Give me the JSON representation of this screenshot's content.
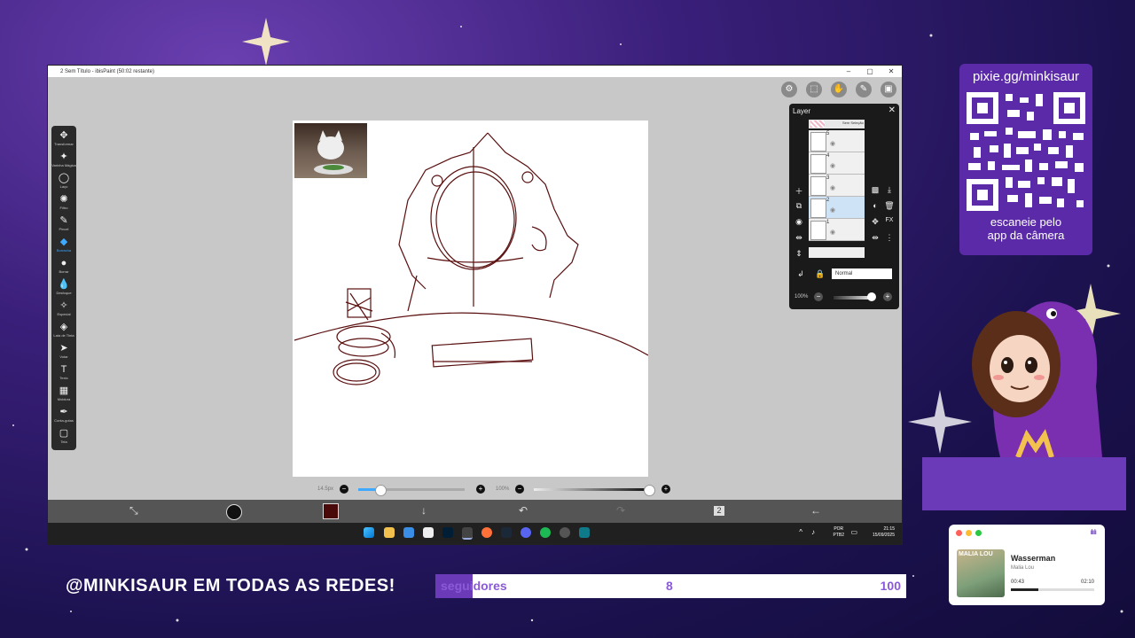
{
  "window": {
    "title": "2 Sem Título - ibisPaint (50:02 restante)",
    "minimize": "–",
    "maximize": "▢",
    "close": "✕"
  },
  "tools": [
    {
      "label": "Transformar",
      "icon": "move-icon",
      "glyph": "✥"
    },
    {
      "label": "Varinha Mágica",
      "icon": "magic-wand-icon",
      "glyph": "✦"
    },
    {
      "label": "Laço",
      "icon": "lasso-icon",
      "glyph": "◯"
    },
    {
      "label": "Filtro",
      "icon": "filter-icon",
      "glyph": "✺"
    },
    {
      "label": "Pincel",
      "icon": "brush-icon",
      "glyph": "✎"
    },
    {
      "label": "Borracha",
      "icon": "eraser-icon",
      "glyph": "◆"
    },
    {
      "label": "Borrar",
      "icon": "smudge-icon",
      "glyph": "●"
    },
    {
      "label": "Desfoque",
      "icon": "blur-icon",
      "glyph": "💧"
    },
    {
      "label": "Especial",
      "icon": "special-icon",
      "glyph": "✧"
    },
    {
      "label": "Lata de Tinta",
      "icon": "bucket-icon",
      "glyph": "◈"
    },
    {
      "label": "Votar",
      "icon": "cursor-icon",
      "glyph": "➤"
    },
    {
      "label": "Texto",
      "icon": "text-icon",
      "glyph": "T"
    },
    {
      "label": "Moldura",
      "icon": "frame-icon",
      "glyph": "▦"
    },
    {
      "label": "Conta-gotas",
      "icon": "eyedropper-icon",
      "glyph": "✒"
    },
    {
      "label": "Tela",
      "icon": "canvas-icon",
      "glyph": "▢"
    }
  ],
  "selected_tool_index": 5,
  "layer_panel": {
    "title": "Layer",
    "close": "✕",
    "layers": [
      {
        "name": "5"
      },
      {
        "name": "4"
      },
      {
        "name": "3"
      },
      {
        "name": "2",
        "selected": true
      },
      {
        "name": "1"
      }
    ],
    "top_layer_label": "Sem Seleção",
    "blend_mode": "Normal",
    "opacity": "100%"
  },
  "sliders": {
    "brush_size": "14.5px",
    "brush_size_fraction": 0.2,
    "brush_opacity": "100%",
    "brush_opacity_fraction": 1.0
  },
  "colors": {
    "brush_color": "#4a0a0a",
    "accent": "#6a3ab8",
    "follow_text": "#8a5ad8"
  },
  "taskbar": {
    "lang1": "POR",
    "lang2": "PTB2",
    "time": "21:15",
    "date": "15/09/2025"
  },
  "qr": {
    "url": "pixie.gg/minkisaur",
    "caption1": "escaneie pelo",
    "caption2": "app da câmera"
  },
  "social_handle": "@MINKISAUR EM TODAS AS REDES!",
  "followers": {
    "label": "seguidores",
    "current": "8",
    "goal": "100",
    "fraction": 0.08
  },
  "music": {
    "song": "Wasserman",
    "artist": "Malia Lou",
    "elapsed": "00:43",
    "total": "02:10",
    "progress": 0.33,
    "album_text": "MALIA LOU"
  }
}
